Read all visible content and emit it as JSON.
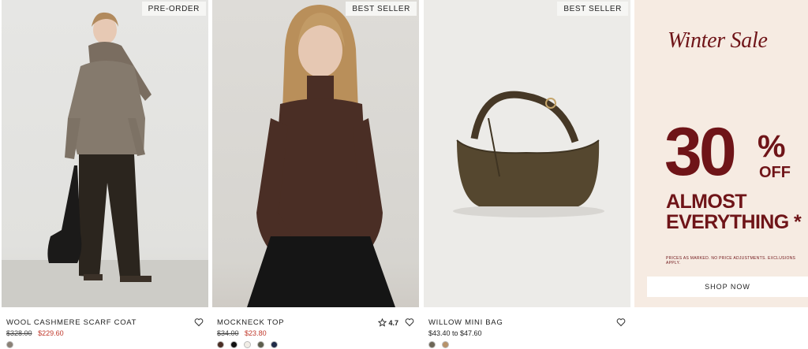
{
  "colors": {
    "sale_red": "#c0392b",
    "promo_burgundy": "#6f1418",
    "promo_bg": "#f6ebe2"
  },
  "products": [
    {
      "badge": "PRE-ORDER",
      "title": "WOOL CASHMERE SCARF COAT",
      "original_price": "$328.00",
      "sale_price": "$229.60",
      "swatches": [
        "#8a8176"
      ]
    },
    {
      "badge": "BEST SELLER",
      "title": "MOCKNECK TOP",
      "rating": "4.7",
      "original_price": "$34.00",
      "sale_price": "$23.80",
      "swatches": [
        "#4a2e25",
        "#111111",
        "#f1ede6",
        "#5d5e4d",
        "#1f2a47"
      ]
    },
    {
      "badge": "BEST SELLER",
      "title": "WILLOW MINI BAG",
      "price_range": "$43.40 to $47.60",
      "swatches": [
        "#6d6656",
        "#b7926a"
      ]
    }
  ],
  "promo": {
    "heading": "Winter Sale",
    "big_number": "30",
    "percent": "%",
    "off": "OFF",
    "line1": "ALMOST",
    "line2": "EVERYTHING *",
    "fine_print": "PRICES AS MARKED. NO PRICE ADJUSTMENTS. EXCLUSIONS APPLY.",
    "cta": "SHOP NOW"
  }
}
